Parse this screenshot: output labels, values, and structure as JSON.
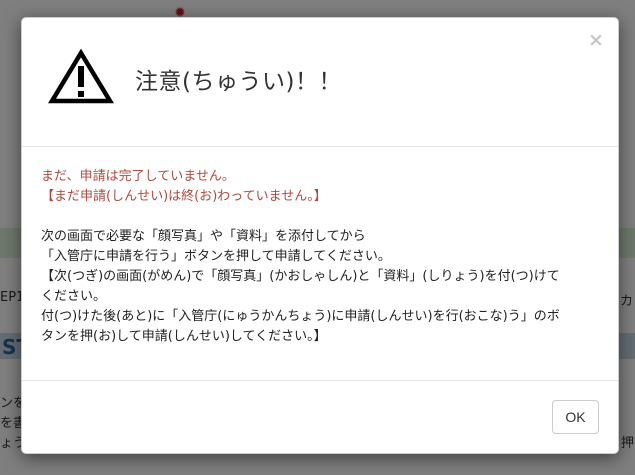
{
  "background": {
    "step_left": "EP1",
    "step_right": "カ",
    "bar_text": "ST",
    "side_lines": [
      "ンを",
      "を書",
      "ょう"
    ],
    "side_right": "押"
  },
  "modal": {
    "title": "注意(ちゅうい)！！",
    "close_label": "×",
    "icon": "warning-triangle-icon",
    "body": {
      "alert_lines": [
        "まだ、申請は完了していません。",
        "【まだ申請(しんせい)は終(お)わっていません。】"
      ],
      "instruction_lines": [
        "次の画面で必要な「顔写真」や「資料」を添付してから",
        "「入管庁に申請を行う」ボタンを押して申請してください。",
        "【次(つぎ)の画面(がめん)で「顔写真」(かおしゃしん)と「資料」(しりょう)を付(つ)けて",
        "ください。",
        "付(つ)けた後(あと)に「入管庁(にゅうかんちょう)に申請(しんせい)を行(おこな)う」のボ",
        "タンを押(お)して申請(しんせい)してください。】"
      ]
    },
    "ok_label": "OK"
  },
  "colors": {
    "alert_text": "#b04a3f",
    "backdrop": "rgba(0,0,0,0.5)"
  }
}
